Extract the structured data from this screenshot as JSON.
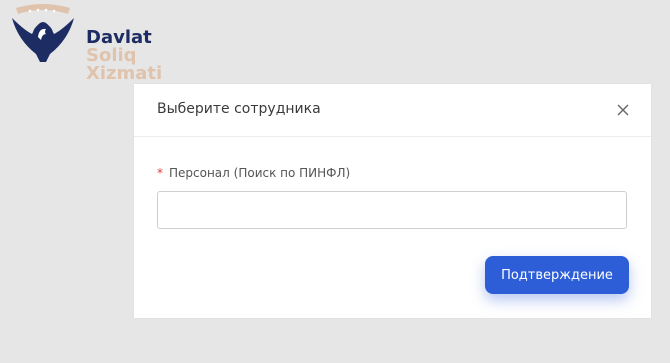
{
  "logo": {
    "line1": "Davlat",
    "line2": "Soliq",
    "line3": "Xizmati",
    "colors": {
      "primary": "#1d2c63",
      "secondary": "#e0c3ad"
    }
  },
  "modal": {
    "title": "Выберите сотрудника",
    "field": {
      "required_mark": "*",
      "label": "Персонал (Поиск по ПИНФЛ)",
      "value": "",
      "placeholder": ""
    },
    "confirm_label": "Подтверждение",
    "close_icon": "close-icon",
    "accent": "#2e5ed7"
  }
}
